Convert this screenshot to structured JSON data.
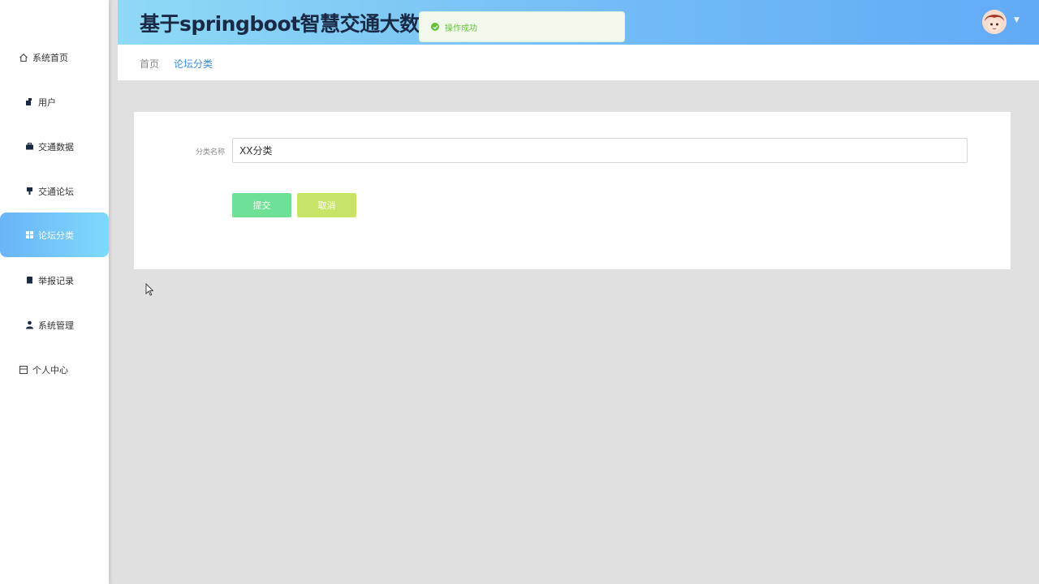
{
  "header": {
    "title": "基于springboot智慧交通大数据"
  },
  "toast": {
    "message": "操作成功"
  },
  "sidebar": {
    "items": [
      {
        "label": "系统首页",
        "icon": "home-icon"
      },
      {
        "label": "用户",
        "icon": "user-icon"
      },
      {
        "label": "交通数据",
        "icon": "briefcase-icon"
      },
      {
        "label": "交通论坛",
        "icon": "pin-icon"
      },
      {
        "label": "论坛分类",
        "icon": "grid-icon",
        "active": true
      },
      {
        "label": "举报记录",
        "icon": "chair-icon"
      },
      {
        "label": "系统管理",
        "icon": "person-icon"
      },
      {
        "label": "个人中心",
        "icon": "panel-icon"
      }
    ]
  },
  "breadcrumb": {
    "home": "首页",
    "current": "论坛分类"
  },
  "form": {
    "category_label": "分类名称",
    "category_value": "XX分类",
    "submit_label": "提交",
    "cancel_label": "取消"
  },
  "colors": {
    "active_item": "#6ab4f8",
    "submit": "#6fe196",
    "cancel": "#c8e466",
    "success": "#67c23a",
    "link": "#3a8ee6"
  }
}
